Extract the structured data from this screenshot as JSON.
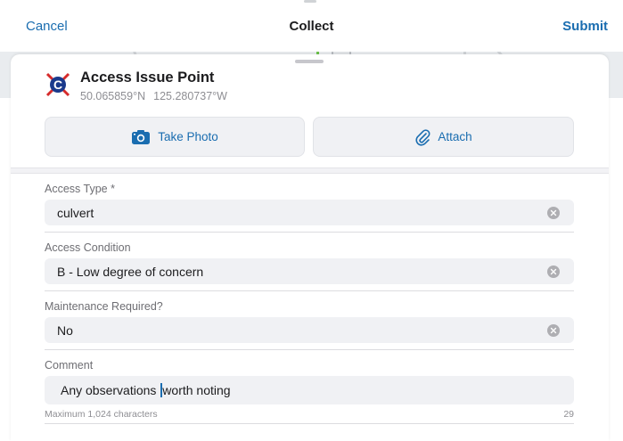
{
  "nav": {
    "cancel_label": "Cancel",
    "title": "Collect",
    "submit_label": "Submit"
  },
  "feature": {
    "title": "Access Issue Point",
    "latitude": "50.065859°N",
    "longitude": "125.280737°W",
    "icon": "feature-symbol-icon"
  },
  "actions": {
    "take_photo_label": "Take Photo",
    "take_photo_icon": "camera-icon",
    "attach_label": "Attach",
    "attach_icon": "paperclip-icon"
  },
  "fields": [
    {
      "label": "Access Type *",
      "value": "culvert"
    },
    {
      "label": "Access Condition",
      "value": "B - Low degree of concern"
    },
    {
      "label": "Maintenance Required?",
      "value": "No"
    }
  ],
  "comment": {
    "label": "Comment",
    "text_before_cursor": "Any observations ",
    "text_after_cursor": "worth noting",
    "hint": "Maximum 1,024 characters",
    "count": "29"
  },
  "colors": {
    "accent": "#1a6db0",
    "field_bg": "#f0f1f4",
    "label": "#6e6e73"
  }
}
